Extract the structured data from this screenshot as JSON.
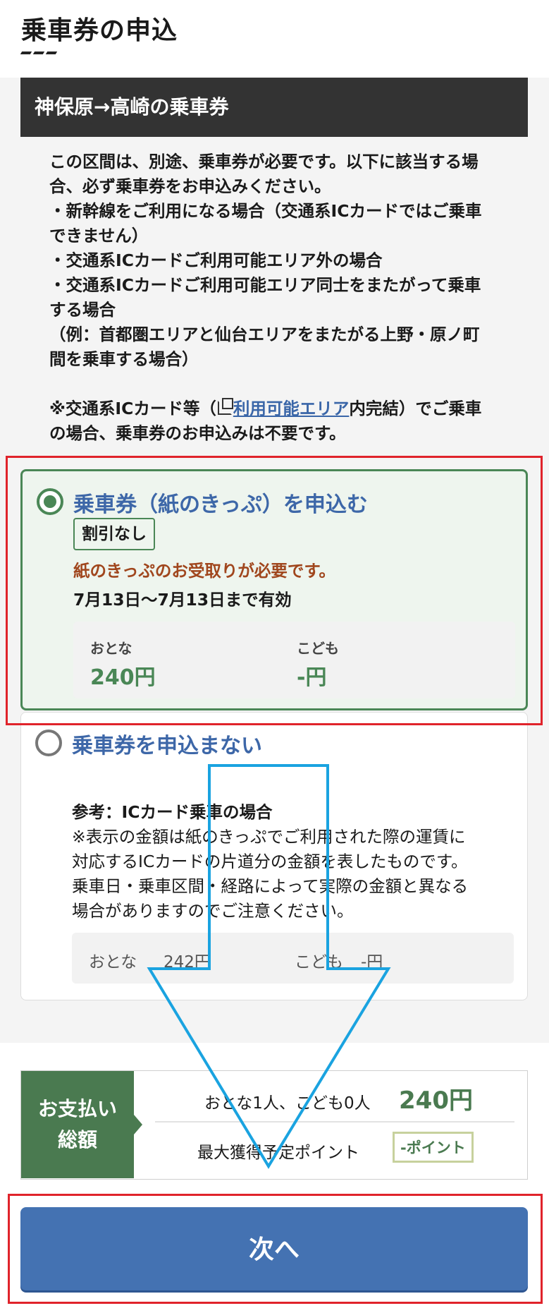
{
  "page": {
    "title": "乗車券の申込"
  },
  "section": {
    "title": "神保原→高崎の乗車券"
  },
  "notice": {
    "lines": [
      "この区間は、別途、乗車券が必要です。以下に該当する場",
      "合、必ず乗車券をお申込みください。",
      "・新幹線をご利用になる場合（交通系ICカードではご乗車",
      "できません）",
      "・交通系ICカードご利用可能エリア外の場合",
      "・交通系ICカードご利用可能エリア同士をまたがって乗車",
      "する場合",
      "（例：首都圏エリアと仙台エリアをまたがる上野・原ノ町",
      "間を乗車する場合）"
    ],
    "note_prefix": "※交通系ICカード等（",
    "note_link": "利用可能エリア",
    "note_suffix_1": "内完結）でご乗車",
    "note_line2": "の場合、乗車券のお申込みは不要です。"
  },
  "option_paper": {
    "label": "乗車券（紙のきっぷ）を申込む",
    "badge": "割引なし",
    "warning": "紙のきっぷのお受取りが必要です。",
    "validity": "7月13日～7月13日まで有効",
    "adult_label": "おとな",
    "adult_price": "240円",
    "child_label": "こども",
    "child_price": "-円",
    "selected": true
  },
  "option_none": {
    "label": "乗車券を申込まない",
    "ref_title": "参考：ICカード乗車の場合",
    "ref_lines": [
      "※表示の金額は紙のきっぷでご利用された際の運賃に",
      "対応するICカードの片道分の金額を表したものです。",
      "乗車日・乗車区間・経路によって実際の金額と異なる",
      "場合がありますのでご注意ください。"
    ],
    "adult_label": "おとな",
    "adult_price": "242円",
    "child_label": "こども",
    "child_price": "-円",
    "selected": false
  },
  "summary": {
    "tag_line1": "お支払い",
    "tag_line2": "総額",
    "people": "おとな1人、こども0人",
    "total": "240円",
    "points_label": "最大獲得予定ポイント",
    "points": "-ポイント"
  },
  "next_button": {
    "label": "次へ"
  },
  "colors": {
    "accent_green": "#4a8756",
    "link_blue": "#3d67a8",
    "button_blue": "#4472b2",
    "highlight_red": "#e0232b",
    "arrow_cyan": "#1aa3e0"
  }
}
